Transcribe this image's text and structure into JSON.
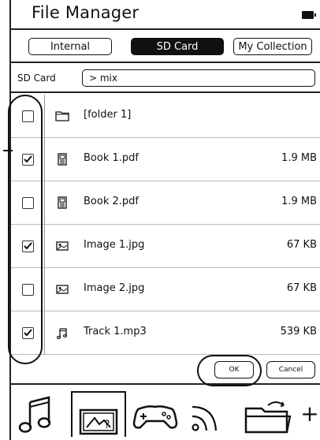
{
  "header": {
    "title": "File Manager",
    "battery_icon": "battery-icon"
  },
  "tabs": [
    {
      "label": "Internal",
      "active": false
    },
    {
      "label": "SD Card",
      "active": true
    },
    {
      "label": "My Collection",
      "active": false
    }
  ],
  "path": {
    "label": "SD Card",
    "value": "> mix"
  },
  "files": [
    {
      "name": "[folder 1]",
      "size": "",
      "icon": "folder-icon",
      "checked": false
    },
    {
      "name": "Book 1.pdf",
      "size": "1.9 MB",
      "icon": "document-icon",
      "checked": true
    },
    {
      "name": "Book 2.pdf",
      "size": "1.9 MB",
      "icon": "document-icon",
      "checked": false
    },
    {
      "name": "Image 1.jpg",
      "size": "67 KB",
      "icon": "image-icon",
      "checked": true
    },
    {
      "name": "Image 2.jpg",
      "size": "67 KB",
      "icon": "image-icon",
      "checked": false
    },
    {
      "name": "Track 1.mp3",
      "size": "539 KB",
      "icon": "music-note-icon",
      "checked": true
    }
  ],
  "actions": {
    "ok_label": "OK",
    "cancel_label": "Cancel"
  },
  "dock": {
    "items": [
      "music-icon",
      "photo-icon",
      "gamepad-icon",
      "rss-icon",
      "folder-open-icon"
    ],
    "add_label": "+"
  }
}
